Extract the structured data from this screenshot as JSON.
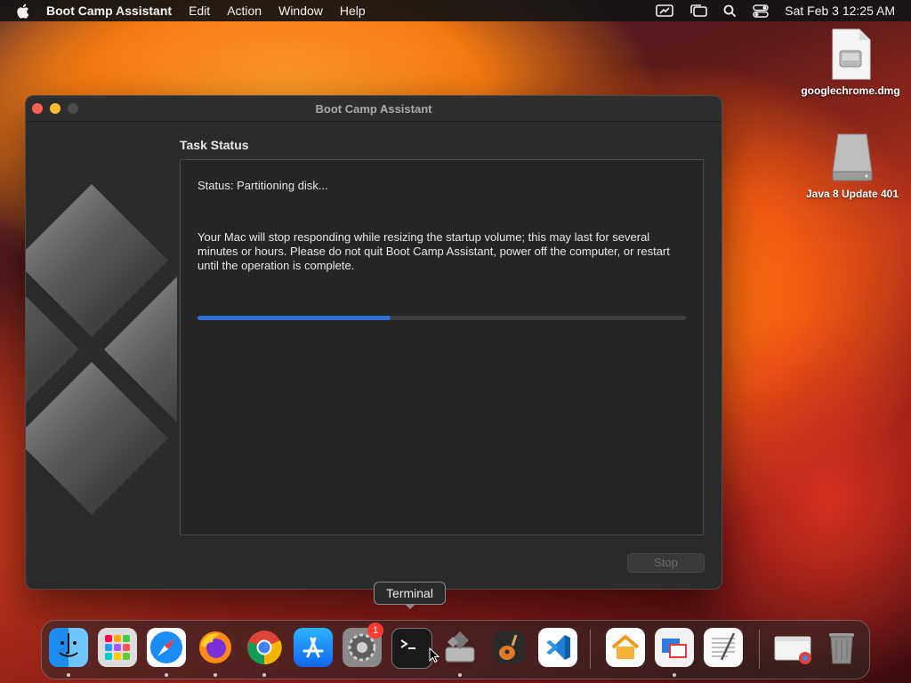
{
  "menubar": {
    "app_name": "Boot Camp Assistant",
    "menus": [
      "Edit",
      "Action",
      "Window",
      "Help"
    ],
    "datetime": "Sat Feb 3  12:25 AM"
  },
  "desktop": {
    "icons": [
      {
        "label": "googlechrome.dmg",
        "icon": "disk-image-icon"
      },
      {
        "label": "Java 8 Update 401",
        "icon": "external-drive-icon"
      }
    ]
  },
  "window": {
    "title": "Boot Camp Assistant",
    "section_title": "Task Status",
    "status_text": "Status: Partitioning disk...",
    "warning_text": "Your Mac will stop responding while resizing the startup volume; this may last for several minutes or hours. Please do not quit Boot Camp Assistant, power off the computer, or restart until the operation is complete.",
    "progress_fraction": 0.395,
    "stop_label": "Stop"
  },
  "tooltip": {
    "text": "Terminal"
  },
  "dock": {
    "items": [
      {
        "icon": "finder-icon",
        "running": true
      },
      {
        "icon": "launchpad-icon",
        "running": false
      },
      {
        "icon": "safari-icon",
        "running": true
      },
      {
        "icon": "firefox-icon",
        "running": true
      },
      {
        "icon": "chrome-icon",
        "running": true
      },
      {
        "icon": "app-store-icon",
        "running": false
      },
      {
        "icon": "system-settings-icon",
        "running": false,
        "badge": "1"
      },
      {
        "icon": "terminal-icon",
        "running": false
      },
      {
        "icon": "boot-camp-icon",
        "running": true
      },
      {
        "icon": "garageband-icon",
        "running": false
      },
      {
        "icon": "vscode-icon",
        "running": false
      },
      {
        "icon": "home-icon",
        "running": false
      },
      {
        "icon": "parallels-icon",
        "running": true
      },
      {
        "icon": "textedit-icon",
        "running": false
      },
      {
        "icon": "chrome-installer-icon",
        "running": false
      },
      {
        "icon": "trash-icon",
        "running": false
      }
    ]
  },
  "colors": {
    "accent": "#2f6fd6",
    "badge": "#fe3b30"
  }
}
